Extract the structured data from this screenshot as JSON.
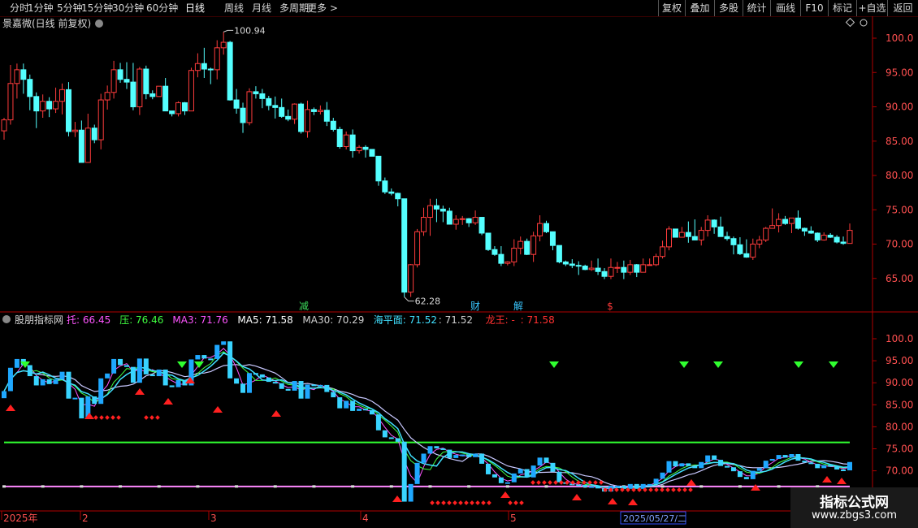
{
  "toolbar": {
    "periods": [
      "分时",
      "1分钟",
      "5分钟",
      "15分钟",
      "30分钟",
      "60分钟",
      "日线",
      "周线",
      "月线",
      "多周期",
      "更多 >"
    ],
    "active_period": "日线",
    "right_buttons": [
      "复权",
      "叠加",
      "多股",
      "统计",
      "画线",
      "F10",
      "标记",
      "+自选",
      "返回"
    ]
  },
  "main_panel": {
    "title": "景嘉微(日线 前复权)",
    "price_labels": [
      "100.0",
      "95.00",
      "90.00",
      "85.00",
      "80.00",
      "75.00",
      "70.00",
      "65.00"
    ],
    "high_label": "100.94",
    "low_label": "62.28",
    "event_markers": [
      {
        "text": "减",
        "color": "#3cd85a"
      },
      {
        "text": "财",
        "color": "#39c6ff"
      },
      {
        "text": "解",
        "color": "#39c6ff"
      },
      {
        "text": "$",
        "color": "#ff3a3a"
      }
    ]
  },
  "indicator_panel": {
    "title": "股朋指标网",
    "legend": [
      {
        "text": "托: 66.45",
        "color": "#ff55ff"
      },
      {
        "text": "压: 76.46",
        "color": "#40ff40"
      },
      {
        "text": "MA3: 71.76",
        "color": "#ff55ff"
      },
      {
        "text": "MA5: 71.58",
        "color": "#ffffff"
      },
      {
        "text": "MA30: 70.29",
        "color": "#d0d0d0"
      },
      {
        "text": "海平面: 71.52",
        "color": "#40e0ff"
      },
      {
        "text": ": 71.52",
        "color": "#d0d0d0"
      },
      {
        "text": "龙王: -",
        "color": "#ff3030"
      },
      {
        "text": ": 71.58",
        "color": "#ff3030"
      }
    ],
    "price_labels": [
      "100.0",
      "95.00",
      "90.00",
      "85.00",
      "80.00",
      "75.00",
      "70.00"
    ],
    "support_value": 66.45,
    "pressure_value": 76.46
  },
  "time_axis": {
    "labels": [
      "2025年",
      "2",
      "3",
      "4",
      "5"
    ],
    "cursor_date": "2025/05/27/二"
  },
  "watermark": {
    "name": "指标公式网",
    "url": "www.zbgs3.com"
  },
  "colors": {
    "up": "#ff3c3c",
    "down": "#54ffff",
    "axis": "#b00000",
    "background": "#000000"
  },
  "candles": [
    [
      86.5,
      88.4,
      85.2,
      88.1
    ],
    [
      88.1,
      96.1,
      87.4,
      93.4
    ],
    [
      93.4,
      96.3,
      91.2,
      95.4
    ],
    [
      95.4,
      96.3,
      91.9,
      94.0
    ],
    [
      94.0,
      94.7,
      89.5,
      91.5
    ],
    [
      91.5,
      92.1,
      86.9,
      89.4
    ],
    [
      89.4,
      91.8,
      88.4,
      90.8
    ],
    [
      90.8,
      91.4,
      88.5,
      89.7
    ],
    [
      89.7,
      92.8,
      89.1,
      90.8
    ],
    [
      90.8,
      93.4,
      88.9,
      92.5
    ],
    [
      92.5,
      93.6,
      85.7,
      86.4
    ],
    [
      86.4,
      87.8,
      85.6,
      86.6
    ],
    [
      86.6,
      88.0,
      81.9,
      81.9
    ],
    [
      81.9,
      89.0,
      81.9,
      86.9
    ],
    [
      86.9,
      87.4,
      84.7,
      85.2
    ],
    [
      85.2,
      91.9,
      83.8,
      91.0
    ],
    [
      91.0,
      93.1,
      89.6,
      92.1
    ],
    [
      92.1,
      96.7,
      91.2,
      95.4
    ],
    [
      95.4,
      96.4,
      93.5,
      94.0
    ],
    [
      94.0,
      96.5,
      92.6,
      93.6
    ],
    [
      93.6,
      96.4,
      89.5,
      90.0
    ],
    [
      90.0,
      95.8,
      88.8,
      95.5
    ],
    [
      95.5,
      96.0,
      91.1,
      91.9
    ],
    [
      91.9,
      92.4,
      91.1,
      91.5
    ],
    [
      91.5,
      93.0,
      91.6,
      93.0
    ],
    [
      93.0,
      94.2,
      89.4,
      89.4
    ],
    [
      89.4,
      89.4,
      88.6,
      89.0
    ],
    [
      89.0,
      90.8,
      88.6,
      90.6
    ],
    [
      90.6,
      90.7,
      88.8,
      89.4
    ],
    [
      89.4,
      95.7,
      89.7,
      95.3
    ],
    [
      95.3,
      97.8,
      94.3,
      96.3
    ],
    [
      96.3,
      98.6,
      94.2,
      95.5
    ],
    [
      95.5,
      95.7,
      93.3,
      95.4
    ],
    [
      95.4,
      99.7,
      94.0,
      98.6
    ],
    [
      98.6,
      100.9,
      97.6,
      99.4
    ],
    [
      99.4,
      99.6,
      90.9,
      91.0
    ],
    [
      91.0,
      92.6,
      89.0,
      89.8
    ],
    [
      89.8,
      90.6,
      86.2,
      87.7
    ],
    [
      87.7,
      92.7,
      87.3,
      92.2
    ],
    [
      92.2,
      93.0,
      91.2,
      91.9
    ],
    [
      91.9,
      92.6,
      89.8,
      91.2
    ],
    [
      91.2,
      91.6,
      89.5,
      90.2
    ],
    [
      90.2,
      91.5,
      88.3,
      89.9
    ],
    [
      89.9,
      91.2,
      88.4,
      88.6
    ],
    [
      88.6,
      89.6,
      87.9,
      88.2
    ],
    [
      88.2,
      90.5,
      87.5,
      90.4
    ],
    [
      90.4,
      90.6,
      86.1,
      86.4
    ],
    [
      86.4,
      90.9,
      85.5,
      89.6
    ],
    [
      89.6,
      89.9,
      88.8,
      89.3
    ],
    [
      89.3,
      90.2,
      88.9,
      89.5
    ],
    [
      89.5,
      90.7,
      87.2,
      87.9
    ],
    [
      87.9,
      88.4,
      86.4,
      86.7
    ],
    [
      86.7,
      87.1,
      83.9,
      84.2
    ],
    [
      84.2,
      86.4,
      83.8,
      85.9
    ],
    [
      85.9,
      86.7,
      82.6,
      83.6
    ],
    [
      83.6,
      84.4,
      83.2,
      84.1
    ],
    [
      84.1,
      84.4,
      82.6,
      83.8
    ],
    [
      83.8,
      83.8,
      82.8,
      82.8
    ],
    [
      82.8,
      82.8,
      78.5,
      79.2
    ],
    [
      79.2,
      79.7,
      77.3,
      77.6
    ],
    [
      77.6,
      78.1,
      77.1,
      77.4
    ],
    [
      77.4,
      77.5,
      75.5,
      76.6
    ],
    [
      76.6,
      76.6,
      62.3,
      63.0
    ],
    [
      63.0,
      67.1,
      62.3,
      67.0
    ],
    [
      67.0,
      72.2,
      66.6,
      71.8
    ],
    [
      71.8,
      75.3,
      71.2,
      73.9
    ],
    [
      73.9,
      76.6,
      71.2,
      75.6
    ],
    [
      75.6,
      76.6,
      73.2,
      75.1
    ],
    [
      75.1,
      75.6,
      73.2,
      74.8
    ],
    [
      74.8,
      75.3,
      72.9,
      72.9
    ],
    [
      72.9,
      74.2,
      72.1,
      73.6
    ],
    [
      73.6,
      74.1,
      72.8,
      73.7
    ],
    [
      73.7,
      73.8,
      72.5,
      73.1
    ],
    [
      73.1,
      74.9,
      72.8,
      73.9
    ],
    [
      73.9,
      73.9,
      71.3,
      71.6
    ],
    [
      71.6,
      71.6,
      69.0,
      69.2
    ],
    [
      69.2,
      69.7,
      68.3,
      68.5
    ],
    [
      68.5,
      69.7,
      66.8,
      67.2
    ],
    [
      67.2,
      67.5,
      66.9,
      67.4
    ],
    [
      67.4,
      70.7,
      66.8,
      69.4
    ],
    [
      69.4,
      71.1,
      68.5,
      70.4
    ],
    [
      70.4,
      70.8,
      68.4,
      68.5
    ],
    [
      68.5,
      71.8,
      67.4,
      71.2
    ],
    [
      71.2,
      74.2,
      70.4,
      73.0
    ],
    [
      73.0,
      73.4,
      71.6,
      71.8
    ],
    [
      71.8,
      71.8,
      69.1,
      69.8
    ],
    [
      69.8,
      69.8,
      67.2,
      67.4
    ],
    [
      67.4,
      67.6,
      66.8,
      67.1
    ],
    [
      67.1,
      67.8,
      66.5,
      66.9
    ],
    [
      66.9,
      67.5,
      65.5,
      66.8
    ],
    [
      66.8,
      67.0,
      66.2,
      66.3
    ],
    [
      66.3,
      67.6,
      66.1,
      66.5
    ],
    [
      66.5,
      67.9,
      65.5,
      66.0
    ],
    [
      66.0,
      66.5,
      64.9,
      65.3
    ],
    [
      65.3,
      67.9,
      64.9,
      66.6
    ],
    [
      66.6,
      67.4,
      65.8,
      66.6
    ],
    [
      66.6,
      67.6,
      64.9,
      65.9
    ],
    [
      65.9,
      67.7,
      65.5,
      67.0
    ],
    [
      67.0,
      67.1,
      65.2,
      65.9
    ],
    [
      65.9,
      67.9,
      65.9,
      67.0
    ],
    [
      67.0,
      67.9,
      67.0,
      67.0
    ],
    [
      67.0,
      68.6,
      66.8,
      68.2
    ],
    [
      68.2,
      70.5,
      67.9,
      69.6
    ],
    [
      69.6,
      72.6,
      69.1,
      72.2
    ],
    [
      72.2,
      72.2,
      71.0,
      71.0
    ],
    [
      71.0,
      72.5,
      71.1,
      71.7
    ],
    [
      71.7,
      73.3,
      70.2,
      71.1
    ],
    [
      71.1,
      73.6,
      70.6,
      70.6
    ],
    [
      70.6,
      72.5,
      69.8,
      72.0
    ],
    [
      72.0,
      74.2,
      71.1,
      73.5
    ],
    [
      73.5,
      73.6,
      71.5,
      72.5
    ],
    [
      72.5,
      74.0,
      71.2,
      71.1
    ],
    [
      71.1,
      71.8,
      70.5,
      70.8
    ],
    [
      70.8,
      71.1,
      68.5,
      69.9
    ],
    [
      69.9,
      71.0,
      68.4,
      68.6
    ],
    [
      68.6,
      70.7,
      68.0,
      68.1
    ],
    [
      68.1,
      70.8,
      67.7,
      70.0
    ],
    [
      70.0,
      71.2,
      69.4,
      70.6
    ],
    [
      70.6,
      72.5,
      70.3,
      72.3
    ],
    [
      72.3,
      75.2,
      72.3,
      72.7
    ],
    [
      72.7,
      74.5,
      71.7,
      73.6
    ],
    [
      73.6,
      74.1,
      72.8,
      73.0
    ],
    [
      73.0,
      73.8,
      71.6,
      73.8
    ],
    [
      73.8,
      74.9,
      72.1,
      72.3
    ],
    [
      72.3,
      72.4,
      71.2,
      71.9
    ],
    [
      71.9,
      72.6,
      71.5,
      71.6
    ],
    [
      71.6,
      71.7,
      70.3,
      70.6
    ],
    [
      70.6,
      71.7,
      70.5,
      71.3
    ],
    [
      71.3,
      71.6,
      70.9,
      71.0
    ],
    [
      71.0,
      71.3,
      70.1,
      70.3
    ],
    [
      70.3,
      71.1,
      69.9,
      70.1
    ],
    [
      70.1,
      73.0,
      70.1,
      72.0
    ]
  ]
}
